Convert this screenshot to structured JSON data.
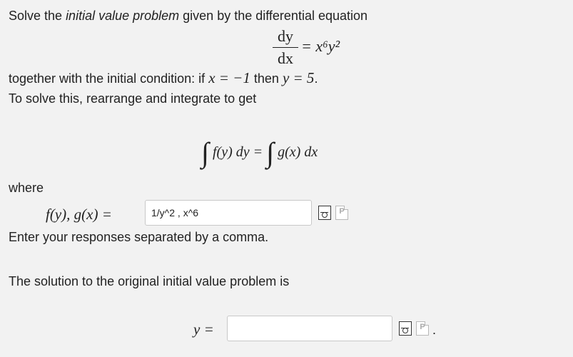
{
  "problem": {
    "intro_prefix": "Solve the ",
    "intro_italic": "initial value problem",
    "intro_suffix": " given by the differential equation",
    "equation": {
      "numerator": "dy",
      "denominator": "dx",
      "rhs": "= x⁶y²"
    },
    "condition_text": "together with the initial condition: if",
    "condition_math": "x = −1",
    "condition_then": "then",
    "condition_math2": "y = 5",
    "condition_end": ".",
    "rearrange_text": "To solve this, rearrange and integrate to get",
    "integral_equation": {
      "left": "f(y) dy =",
      "right": "g(x) dx"
    },
    "where_label": "where",
    "fg_label": "f(y), g(x) =",
    "fg_value": "1/y^2 , x^6",
    "separator_note": "Enter your responses separated by a comma.",
    "solution_text": "The solution to the original initial value problem is",
    "y_label": "y =",
    "y_value": "",
    "trailing_period": "."
  },
  "icons": {
    "preview": "preview-icon",
    "help": "help-icon"
  }
}
